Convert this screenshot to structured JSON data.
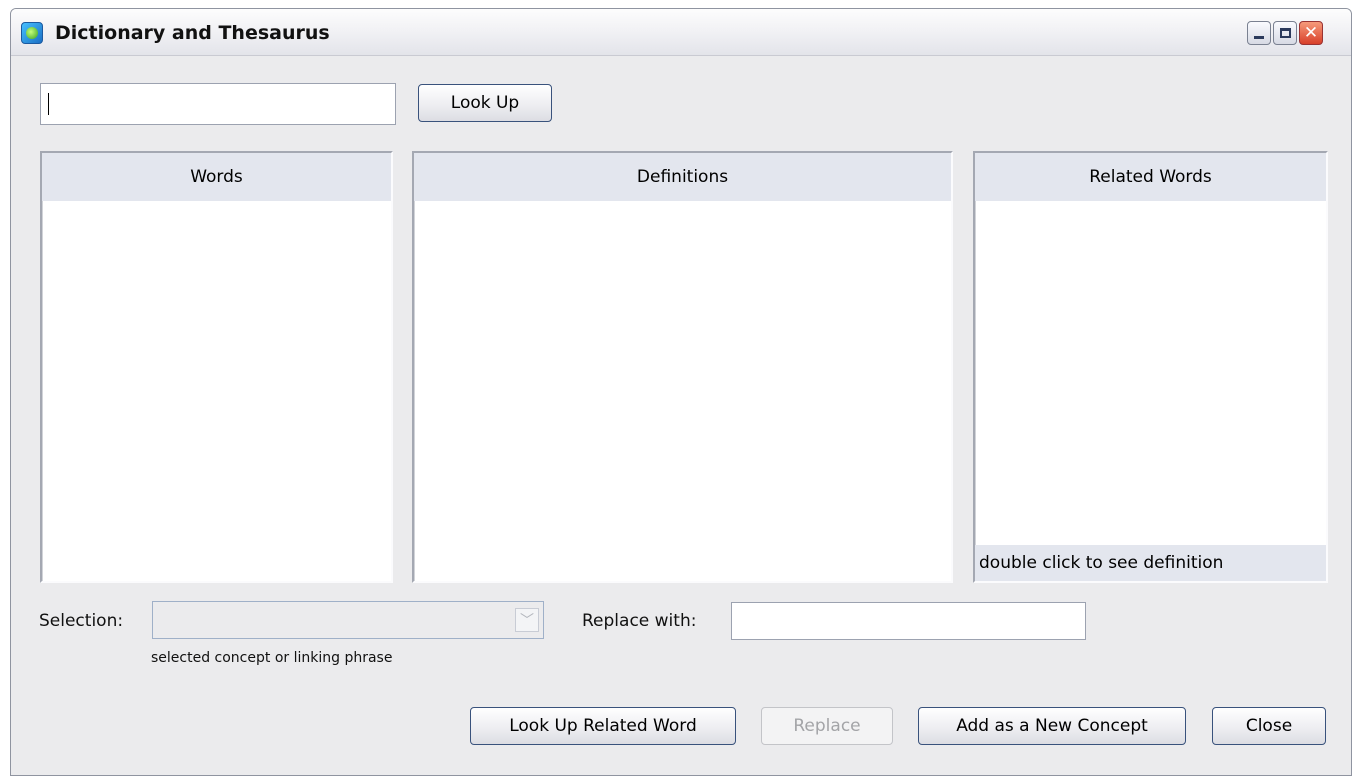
{
  "window": {
    "title": "Dictionary and Thesaurus"
  },
  "search": {
    "value": "",
    "lookup_label": "Look Up"
  },
  "panels": {
    "words": {
      "header": "Words"
    },
    "definitions": {
      "header": "Definitions"
    },
    "related": {
      "header": "Related Words",
      "footer": "double click to see definition"
    }
  },
  "selection": {
    "label": "Selection:",
    "value": "",
    "hint": "selected concept or linking phrase",
    "icon": "chevron-down-icon"
  },
  "replace": {
    "label": "Replace with:",
    "value": ""
  },
  "actions": {
    "lookup_related": "Look Up Related Word",
    "replace": "Replace",
    "add_concept": "Add as a New Concept",
    "close": "Close"
  },
  "colors": {
    "window_bg": "#ebebed",
    "panel_header": "#e3e6ee",
    "close_button": "#d8402a"
  }
}
